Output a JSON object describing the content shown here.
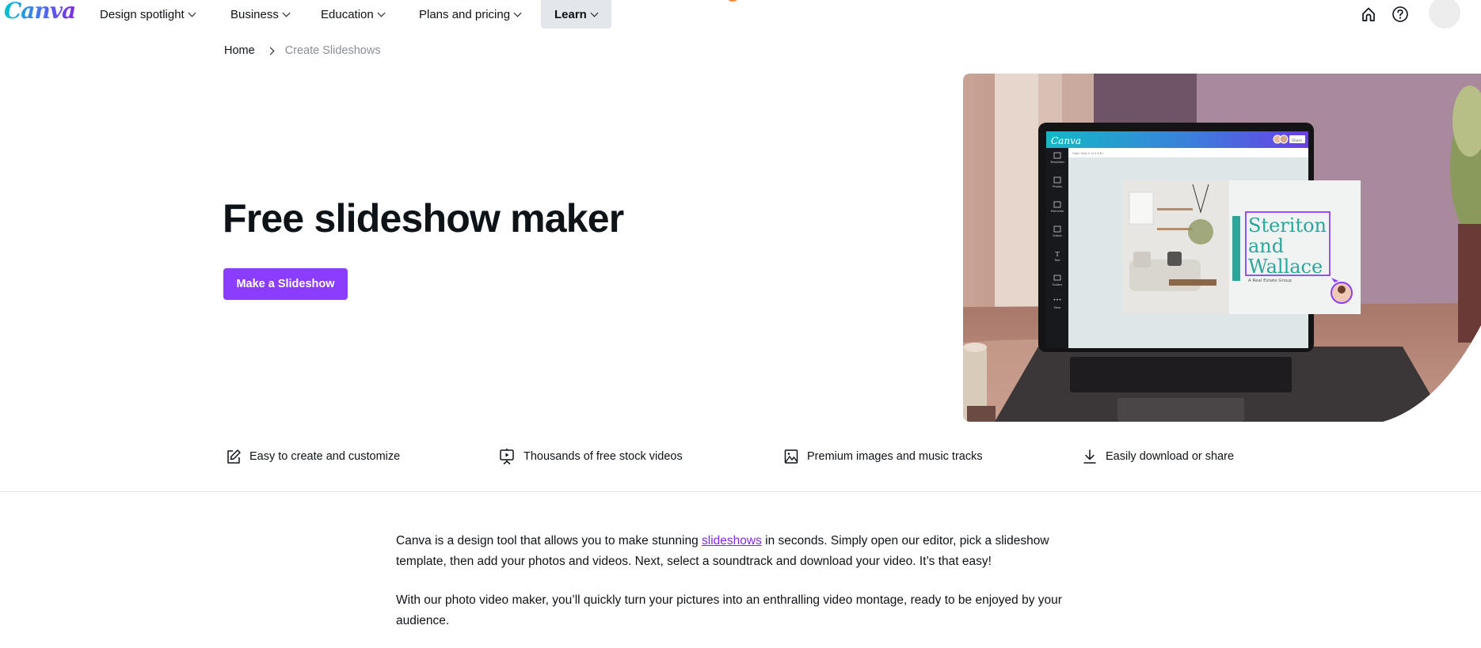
{
  "nav": {
    "logo": "Canva",
    "items": [
      {
        "label": "Design spotlight"
      },
      {
        "label": "Business"
      },
      {
        "label": "Education"
      },
      {
        "label": "Plans and pricing"
      },
      {
        "label": "Learn",
        "active": true
      }
    ],
    "icons": [
      "home-icon",
      "help-icon",
      "avatar"
    ]
  },
  "breadcrumb": {
    "home": "Home",
    "current": "Create Slideshows"
  },
  "hero": {
    "title": "Free slideshow maker",
    "cta_label": "Make a Slideshow",
    "image": {
      "description": "Laptop on a desk showing the Canva editor with a slideshow slide",
      "editor_logo": "Canva",
      "editor_share": "Share",
      "editor_sidebar": [
        "Templates",
        "Photos",
        "Elements",
        "Videos",
        "Text",
        "Folders",
        "More"
      ],
      "slide_title_lines": [
        "Steriton",
        "and",
        "Wallace"
      ],
      "slide_subtitle": "A Real Estate Group"
    }
  },
  "features": [
    {
      "icon": "pencil-edit-icon",
      "label": "Easy to create and customize"
    },
    {
      "icon": "presentation-video-icon",
      "label": "Thousands of free stock videos"
    },
    {
      "icon": "image-icon",
      "label": "Premium images and music tracks"
    },
    {
      "icon": "download-icon",
      "label": "Easily download or share"
    }
  ],
  "copy": {
    "p1_before": "Canva is a design tool that allows you to make stunning ",
    "p1_link": "slideshows",
    "p1_after": " in seconds. Simply open our editor, pick a slideshow template, then add your photos and videos. Next, select a soundtrack and download your video. It’s that easy!",
    "p2": "With our photo video maker, you’ll quickly turn your pictures into an enthralling video montage, ready to be enjoyed by your audience."
  },
  "colors": {
    "brand_purple": "#8b3dff",
    "link_purple": "#7d2ae8",
    "nav_active_bg": "#e3e6ea",
    "slide_teal": "#2aa79b"
  }
}
